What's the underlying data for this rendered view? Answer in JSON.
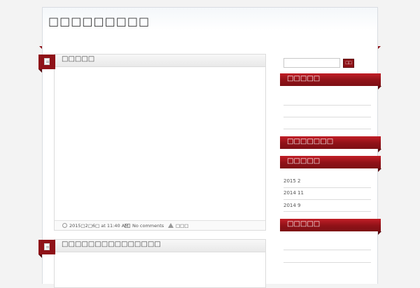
{
  "header": {
    "site_title": "□□□□□□□□□"
  },
  "posts": [
    {
      "title": "□□□□□",
      "meta": {
        "date": "2015□2□6□ at 11:40 AM",
        "comments": "No comments",
        "author": "□□□"
      }
    },
    {
      "title": "□□□□□□□□□□□□□□□"
    }
  ],
  "sidebar": {
    "search": {
      "placeholder": "",
      "button_label": "□□"
    },
    "widgets": [
      {
        "title": "□□□□□"
      },
      {
        "title": "□□□□□□□"
      },
      {
        "title": "□□□□□",
        "items": [
          "2015 2",
          "2014 11",
          "2014 9"
        ]
      },
      {
        "title": "□□□□□"
      }
    ]
  },
  "colors": {
    "accent": "#8f1218",
    "accent_light": "#c21e26",
    "background": "#f3f3f3"
  },
  "icons": {
    "post": "document-icon",
    "date": "clock-icon",
    "comments": "mail-icon",
    "author": "user-icon"
  }
}
